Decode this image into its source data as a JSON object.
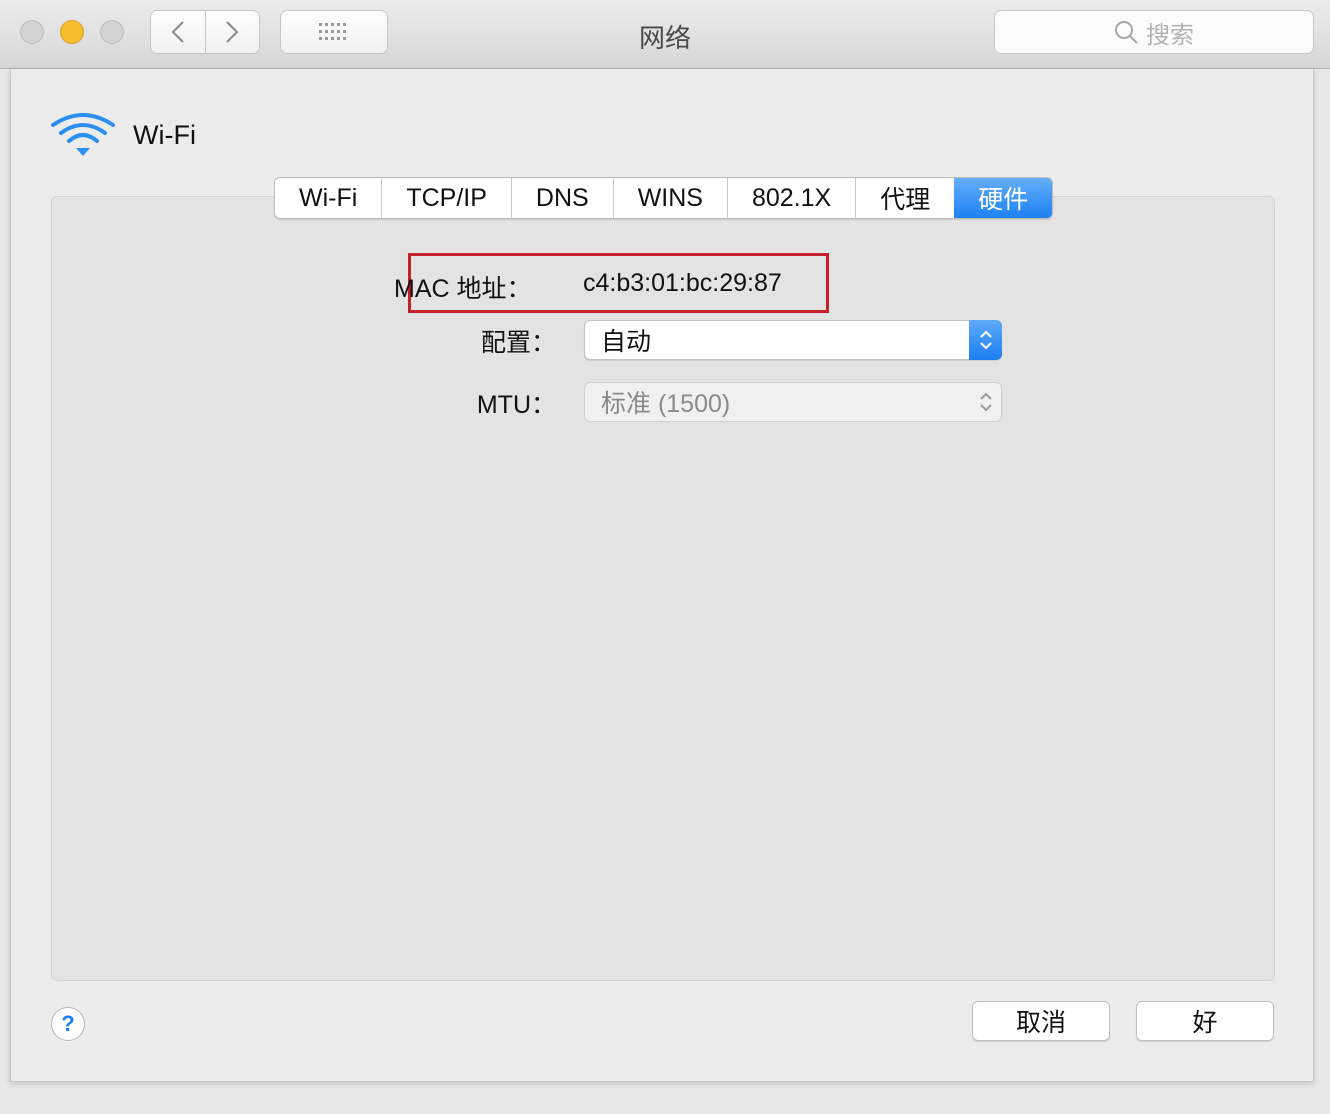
{
  "window": {
    "title": "网络",
    "search_placeholder": "搜索"
  },
  "interface": {
    "name": "Wi-Fi"
  },
  "tabs": [
    {
      "label": "Wi-Fi",
      "active": false
    },
    {
      "label": "TCP/IP",
      "active": false
    },
    {
      "label": "DNS",
      "active": false
    },
    {
      "label": "WINS",
      "active": false
    },
    {
      "label": "802.1X",
      "active": false
    },
    {
      "label": "代理",
      "active": false
    },
    {
      "label": "硬件",
      "active": true
    }
  ],
  "hardware": {
    "mac_label": "MAC 地址：",
    "mac_value": "c4:b3:01:bc:29:87",
    "config_label": "配置：",
    "config_value": "自动",
    "mtu_label": "MTU：",
    "mtu_value": "标准 (1500)"
  },
  "footer": {
    "help_label": "?",
    "cancel_label": "取消",
    "ok_label": "好"
  },
  "colors": {
    "accent": "#1d82f4",
    "highlight_box": "#c4202a"
  }
}
